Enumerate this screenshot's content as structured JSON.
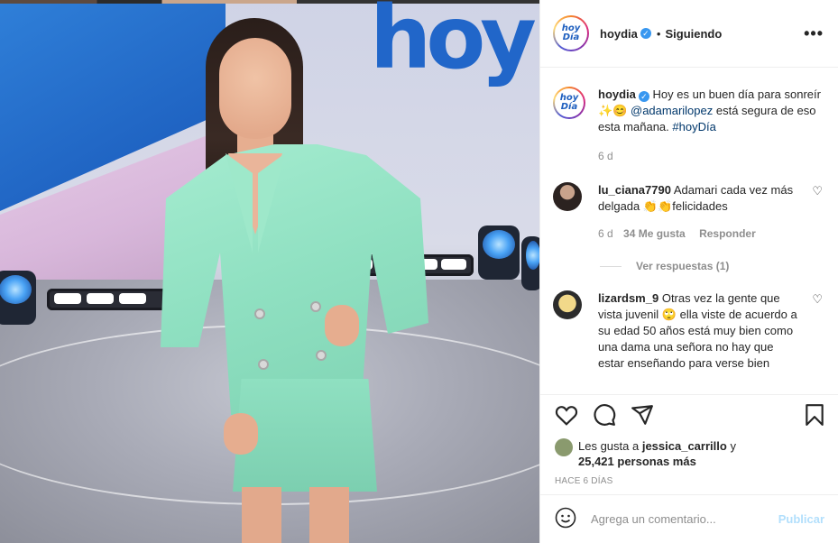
{
  "post": {
    "account": "hoydia",
    "avatar_text": "hoy\nDía",
    "verified": true,
    "following_label": "Siguiendo",
    "more_label": "•••"
  },
  "caption": {
    "username": "hoydia",
    "text_a": "Hoy es un buen día para sonreír",
    "emoji": "✨😊",
    "mention": "@adamarilopez",
    "text_b": "está segura de eso esta mañana.",
    "hashtag": "#hoyDía",
    "age": "6 d"
  },
  "comments": [
    {
      "username": "lu_ciana7790",
      "text": "Adamari cada vez más delgada",
      "emoji": "👏👏",
      "text_end": "felicidades",
      "age": "6 d",
      "likes": "34 Me gusta",
      "reply_label": "Responder",
      "view_replies": "Ver respuestas (1)"
    },
    {
      "username": "lizardsm_9",
      "text": "Otras vez la gente que vista juvenil",
      "emoji": "🙄",
      "text_end": "ella viste de acuerdo a su edad 50 años está muy bien como una dama una señora no hay que estar enseñando para verse bien"
    }
  ],
  "likes": {
    "prefix": "Les gusta a",
    "user": "jessica_carrillo",
    "connector": "y",
    "count": "25,421 personas más"
  },
  "post_date": "HACE 6 DÍAS",
  "add_comment": {
    "placeholder": "Agrega un comentario...",
    "publish_label": "Publicar"
  },
  "icons": [
    "heart-icon",
    "comment-icon",
    "share-icon",
    "bookmark-icon",
    "emoji-icon",
    "more-icon",
    "verified-icon"
  ],
  "colors": {
    "accent": "#3897f0",
    "publish_disabled": "#b2dffc",
    "link": "#00376b",
    "muted": "#8e8e8e"
  },
  "photo_text": "hoy"
}
